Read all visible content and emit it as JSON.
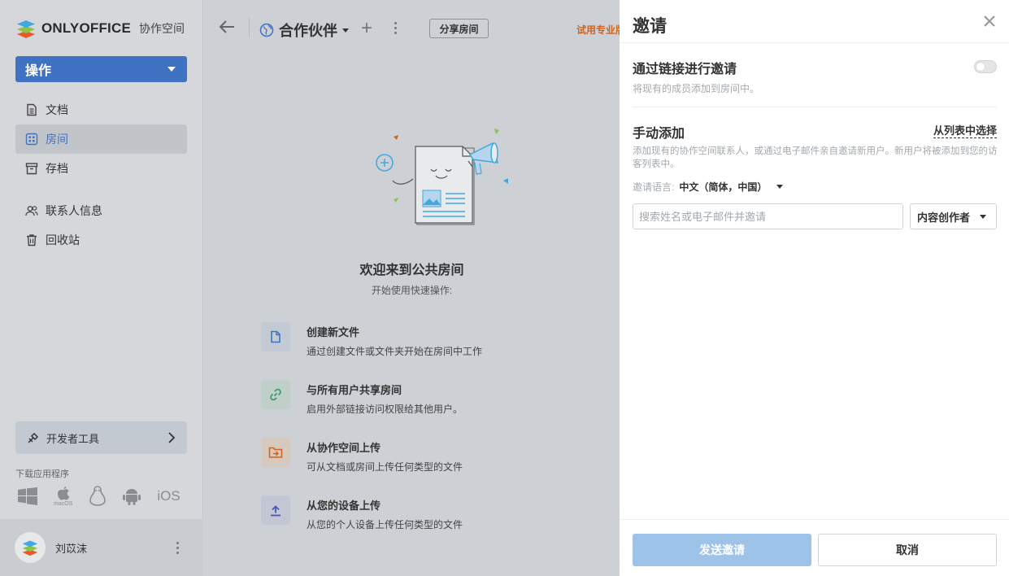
{
  "app": {
    "brand": "ONLYOFFICE",
    "brand_sub": "协作空间"
  },
  "sidebar": {
    "action_label": "操作",
    "items": [
      {
        "label": "文档",
        "icon": "document-icon"
      },
      {
        "label": "房间",
        "icon": "rooms-icon",
        "active": true
      },
      {
        "label": "存档",
        "icon": "archive-icon"
      },
      {
        "label": "联系人信息",
        "icon": "contacts-icon"
      },
      {
        "label": "回收站",
        "icon": "trash-icon"
      }
    ],
    "dev_tools_label": "开发者工具",
    "download_label": "下载应用程序",
    "download_apps": [
      "windows-icon",
      "macos-icon",
      "linux-icon",
      "android-icon",
      "ios"
    ],
    "macos_label": "macOS",
    "ios_label": "iOS",
    "user_name": "刘苡沫"
  },
  "main": {
    "room_title": "合作伙伴",
    "share_label": "分享房间",
    "trial_label": "试用专业版",
    "welcome_title": "欢迎来到公共房间",
    "welcome_sub": "开始使用快速操作:",
    "quick_actions": [
      {
        "title": "创建新文件",
        "desc": "通过创建文件或文件夹开始在房间中工作",
        "icon": "new-file-icon",
        "color": "#3f72c3",
        "bg": "#c3cad3"
      },
      {
        "title": "与所有用户共享房间",
        "desc": "启用外部链接访问权限给其他用户。",
        "icon": "link-icon",
        "color": "#3b9a6a",
        "bg": "#c1cfcb"
      },
      {
        "title": "从协作空间上传",
        "desc": "可从文档或房间上传任何类型的文件",
        "icon": "upload-folder-icon",
        "color": "#d4621a",
        "bg": "#d6c9bd"
      },
      {
        "title": "从您的设备上传",
        "desc": "从您的个人设备上传任何类型的文件",
        "icon": "upload-icon",
        "color": "#4a55b8",
        "bg": "#c3c6d4"
      }
    ]
  },
  "panel": {
    "title": "邀请",
    "link_invite_title": "通过链接进行邀请",
    "link_invite_desc": "将现有的成员添加到房间中。",
    "link_invite_enabled": false,
    "manual_title": "手动添加",
    "from_list_label": "从列表中选择",
    "manual_desc": "添加现有的协作空间联系人，或通过电子邮件亲自邀请新用户。新用户将被添加到您的访客列表中。",
    "language_label": "邀请语言:",
    "language_value": "中文（简体，中国）",
    "search_placeholder": "搜索姓名或电子邮件并邀请",
    "role_value": "内容创作者",
    "send_label": "发送邀请",
    "cancel_label": "取消"
  },
  "colors": {
    "accent": "#3f72c3",
    "send_disabled": "#9dc4e8",
    "trial": "#d4621a"
  }
}
